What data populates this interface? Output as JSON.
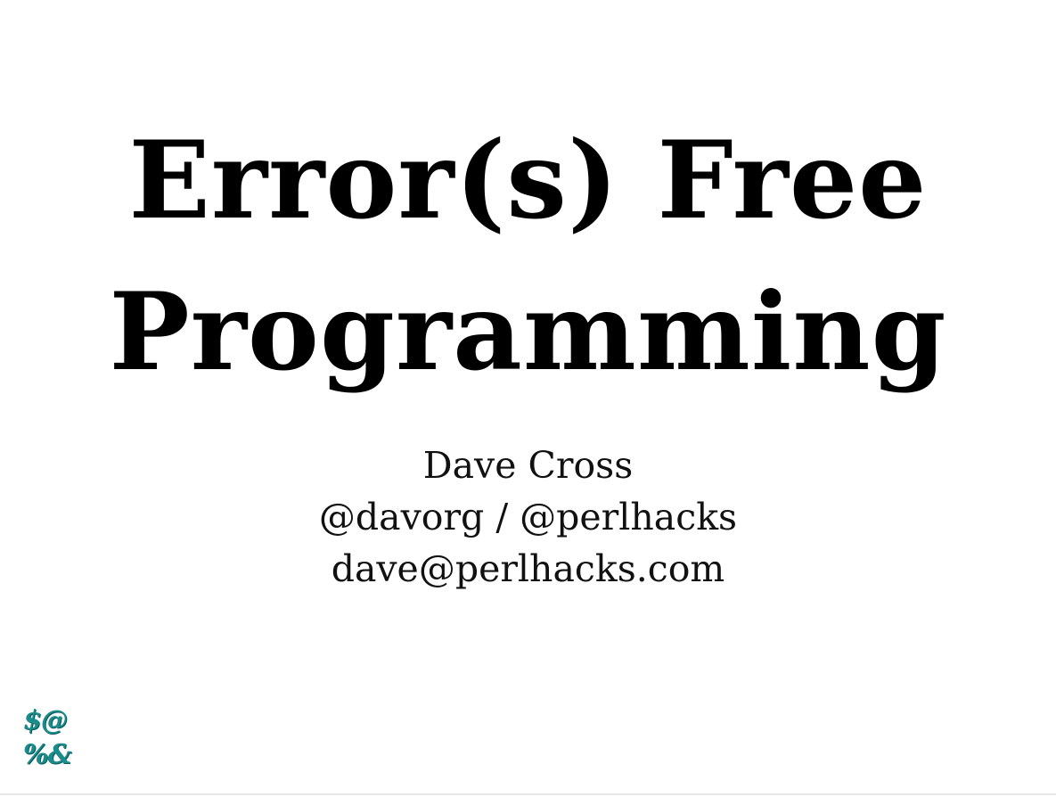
{
  "slide": {
    "title_lines": [
      "Error(s) Free",
      "Programming"
    ],
    "author": "Dave Cross",
    "handles": "@davorg / @perlhacks",
    "email": "dave@perlhacks.com",
    "logo_lines": [
      "$@",
      "%&"
    ]
  },
  "colors": {
    "background": "#ffffff",
    "text": "#000000",
    "logo": "#1a8c8c"
  }
}
